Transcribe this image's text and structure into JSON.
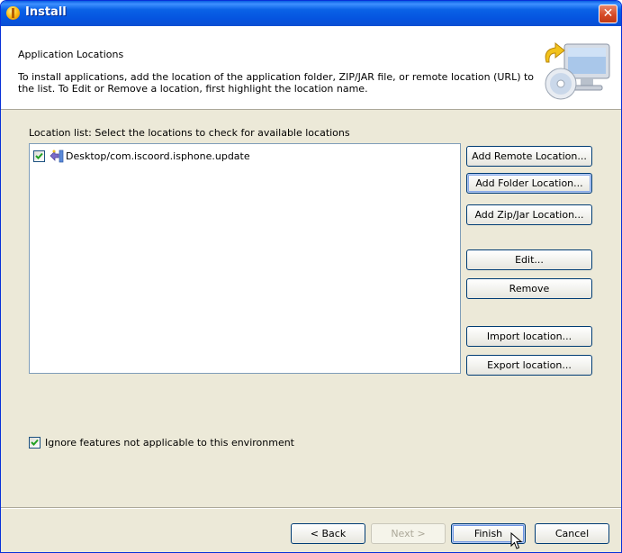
{
  "window": {
    "title": "Install",
    "close_glyph": "✕"
  },
  "banner": {
    "title": "Application Locations",
    "description": "To install applications, add the location of the application folder, ZIP/JAR file, or remote location (URL) to the list. To Edit or Remove a location, first highlight the location name.",
    "graphic_icon": "install-computer-icon"
  },
  "locations": {
    "label": "Location list: Select the locations to check for available locations",
    "items": [
      {
        "label": "Desktop/com.iscoord.isphone.update",
        "checked": true,
        "icon": "update-site-icon"
      }
    ]
  },
  "side_buttons": {
    "add_remote": "Add Remote Location...",
    "add_folder": "Add Folder Location...",
    "add_zip": "Add Zip/Jar Location...",
    "edit": "Edit...",
    "remove": "Remove",
    "import": "Import location...",
    "export": "Export location..."
  },
  "options": {
    "ignore_label": "Ignore features not applicable to this environment",
    "ignore_checked": true
  },
  "footer": {
    "back": "< Back",
    "next": "Next >",
    "finish": "Finish",
    "cancel": "Cancel"
  },
  "colors": {
    "titlebar": "#0554e0",
    "dialog_bg": "#ece9d8",
    "button_border": "#003c74",
    "check_green": "#21a121"
  }
}
